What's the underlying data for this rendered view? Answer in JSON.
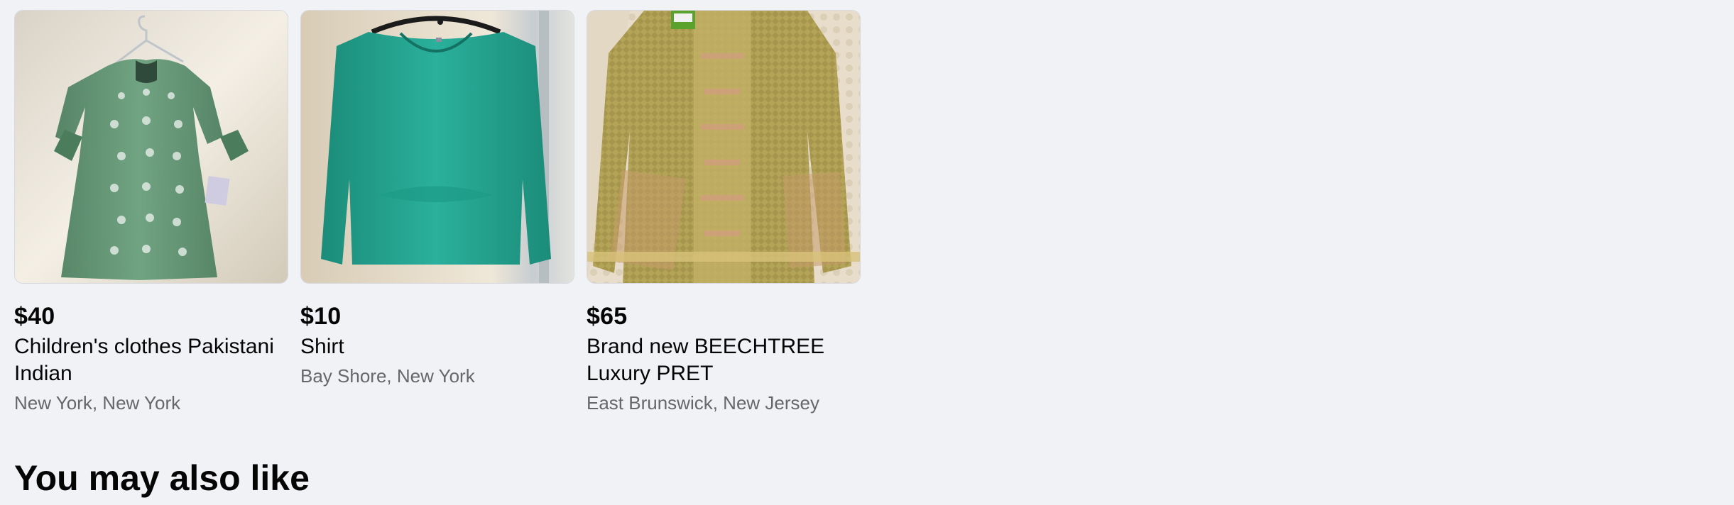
{
  "listings": [
    {
      "price": "$40",
      "title": "Children's clothes Pakistani Indian",
      "location": "New York, New York",
      "image_colors": {
        "background": "#ece6db",
        "garment": "#5f9272",
        "accent": "#dfe8e1"
      }
    },
    {
      "price": "$10",
      "title": "Shirt",
      "location": "Bay Shore, New York",
      "image_colors": {
        "background": "#e9e1d3",
        "garment": "#26a390",
        "accent": "#1d8777"
      }
    },
    {
      "price": "$65",
      "title": "Brand new BEECHTREE Luxury PRET",
      "location": "East Brunswick, New Jersey",
      "image_colors": {
        "background": "#e6dccb",
        "garment": "#b8a85a",
        "accent": "#d79a84"
      }
    }
  ],
  "section": {
    "title": "You may also like"
  }
}
